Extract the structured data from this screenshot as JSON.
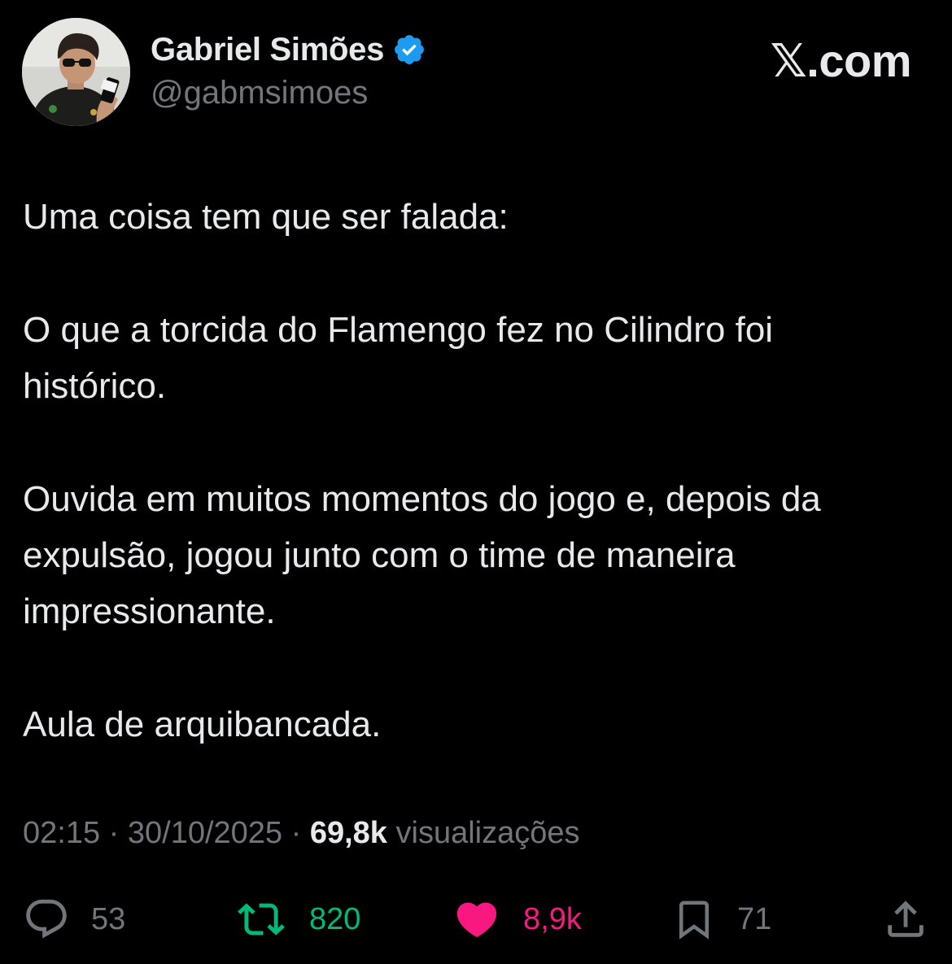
{
  "author": {
    "name": "Gabriel Simões",
    "handle": "@gabmsimoes",
    "verified": true
  },
  "brand": "𝕏.com",
  "tweet": {
    "paragraphs": [
      "Uma coisa tem que ser falada:",
      "O que a torcida do Flamengo fez no Cilindro foi histórico.",
      "Ouvida em muitos momentos do jogo e, depois da expulsão, jogou junto com o time de maneira impressionante.",
      "Aula de arquibancada."
    ]
  },
  "meta": {
    "time": "02:15",
    "separator": " · ",
    "date": "30/10/2025",
    "views": "69,8k",
    "views_label": "visualizações"
  },
  "actions": {
    "replies": "53",
    "retweets": "820",
    "likes": "8,9k",
    "bookmarks": "71"
  },
  "icons": {
    "reply": "reply-icon",
    "retweet": "retweet-icon",
    "like": "heart-icon",
    "bookmark": "bookmark-icon",
    "share": "share-icon",
    "verified": "verified-badge-icon"
  },
  "colors": {
    "background": "#000000",
    "text": "#e7e9ea",
    "muted": "#71767b",
    "retweet": "#00ba7c",
    "like": "#f91880",
    "verified": "#1d9bf0"
  }
}
